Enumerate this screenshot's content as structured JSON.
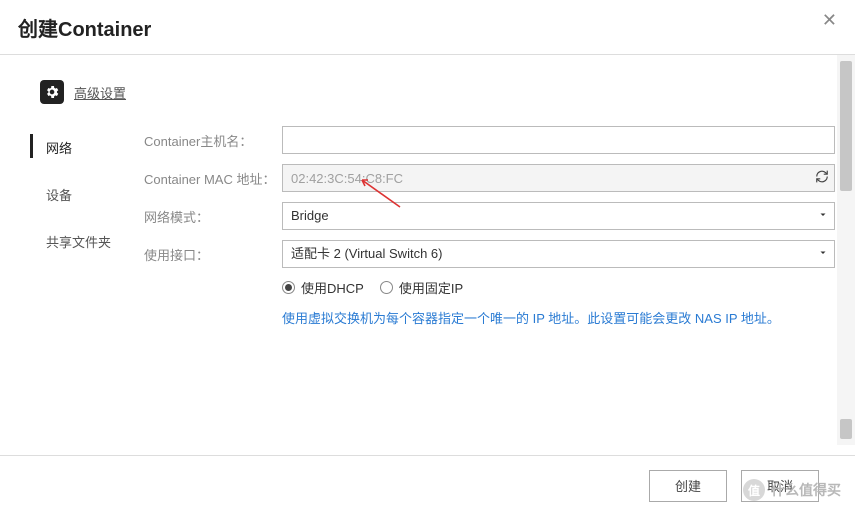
{
  "header": {
    "title": "创建Container"
  },
  "section": {
    "advanced_label": "高级设置"
  },
  "sidebar": {
    "items": [
      {
        "label": "网络"
      },
      {
        "label": "设备"
      },
      {
        "label": "共享文件夹"
      }
    ]
  },
  "form": {
    "hostname": {
      "label": "Container主机名：",
      "value": ""
    },
    "mac": {
      "label": "Container MAC 地址：",
      "value": "02:42:3C:54:C8:FC"
    },
    "mode": {
      "label": "网络模式：",
      "value": "Bridge"
    },
    "iface": {
      "label": "使用接口：",
      "value": "适配卡 2 (Virtual Switch 6)"
    },
    "radio": {
      "dhcp": "使用DHCP",
      "static": "使用固定IP"
    },
    "hint": "使用虚拟交换机为每个容器指定一个唯一的 IP 地址。此设置可能会更改 NAS IP 地址。"
  },
  "footer": {
    "create": "创建",
    "cancel": "取消"
  },
  "watermark": "什么值得买"
}
